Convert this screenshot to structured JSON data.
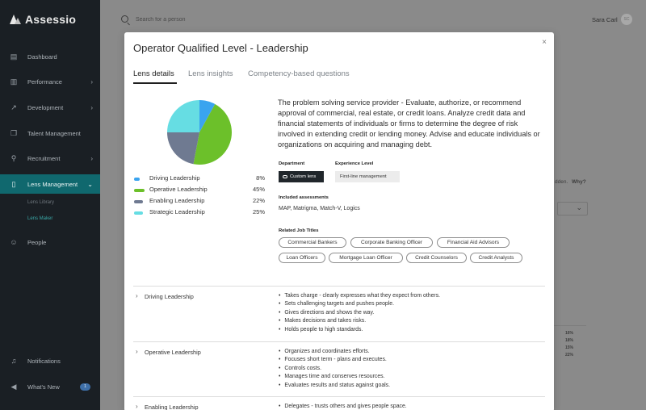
{
  "app": {
    "name": "Assessio"
  },
  "sidebar": {
    "items": [
      {
        "label": "Dashboard",
        "icon": "dashboard-icon"
      },
      {
        "label": "Performance",
        "icon": "bar-chart-icon",
        "chevron": "›"
      },
      {
        "label": "Development",
        "icon": "trend-icon",
        "chevron": "›"
      },
      {
        "label": "Talent Management",
        "icon": "cards-icon"
      },
      {
        "label": "Recruitment",
        "icon": "add-user-icon",
        "chevron": "›"
      },
      {
        "label": "Lens Management",
        "icon": "book-icon",
        "chevron": "⌄"
      },
      {
        "label": "People",
        "icon": "people-icon"
      }
    ],
    "sub_items": [
      "Lens Library",
      "Lens Maker"
    ],
    "bottom": [
      {
        "label": "Notifications",
        "icon": "bell-icon"
      },
      {
        "label": "What's New",
        "icon": "megaphone-icon",
        "badge": "1"
      }
    ]
  },
  "topbar": {
    "search_placeholder": "Search for a person",
    "user_name": "Sara Carl",
    "user_initials": "SC"
  },
  "background": {
    "hidden_text": "dden.",
    "why_link": "Why?",
    "percents": [
      "16%",
      "18%",
      "15%",
      "22%"
    ]
  },
  "modal": {
    "title": "Operator Qualified Level - Leadership",
    "close": "×",
    "tabs": [
      "Lens details",
      "Lens insights",
      "Competency-based questions"
    ],
    "description": "The problem solving service provider - Evaluate, authorize, or recommend approval of commercial, real estate, or credit loans. Analyze credit data and financial statements of individuals or firms to determine the degree of risk involved in extending credit or lending money. Advise and educate individuals or organizations on acquiring and managing debt.",
    "department_label": "Department",
    "department_value": "Custom lens",
    "experience_label": "Experience Level",
    "experience_value": "First-line management",
    "assessments_label": "Included assessments",
    "assessments_value": "MAP,  Matrigma, Match-V, Logics",
    "job_titles_label": "Related Job Titles",
    "job_titles": [
      "Commercial Bankers",
      "Corporate Banking Officer",
      "Financial Aid Advisors",
      "Loan Officers",
      "Mortgage Loan Officer",
      "Credit Counselors",
      "Credit Analysts"
    ],
    "accordion": [
      {
        "title": "Driving Leadership",
        "chevron": "›",
        "bullets": [
          "Takes charge - clearly expresses what they expect from others.",
          "Sets challenging targets and pushes people.",
          "Gives directions and shows the way.",
          "Makes decisions and takes risks.",
          "Holds people to high standards."
        ]
      },
      {
        "title": "Operative Leadership",
        "chevron": "›",
        "bullets": [
          "Organizes and coordinates efforts.",
          "Focuses short term - plans and executes.",
          "Controls costs.",
          "Manages time and conserves resources.",
          "Evaluates results and status against goals."
        ]
      },
      {
        "title": "Enabling Leadership",
        "chevron": "›",
        "bullets": [
          "Delegates - trusts others and gives people space."
        ]
      }
    ]
  },
  "chart_data": {
    "type": "pie",
    "series": [
      {
        "name": "Driving Leadership",
        "value": 8,
        "label": "8%",
        "color": "#3aa4ef"
      },
      {
        "name": "Operative Leadership",
        "value": 45,
        "label": "45%",
        "color": "#6cc02a"
      },
      {
        "name": "Enabling Leadership",
        "value": 22,
        "label": "22%",
        "color": "#6f7a91"
      },
      {
        "name": "Strategic Leadership",
        "value": 25,
        "label": "25%",
        "color": "#66dde3"
      }
    ]
  }
}
